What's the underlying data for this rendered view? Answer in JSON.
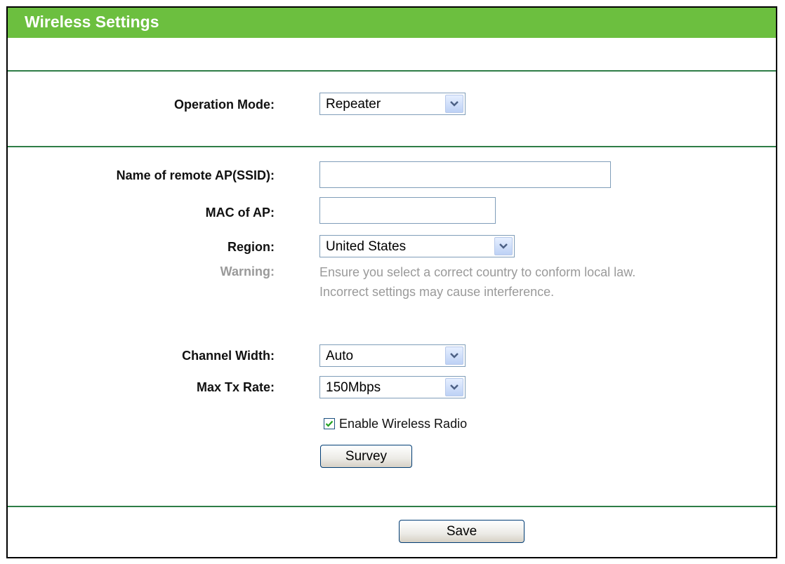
{
  "page": {
    "title": "Wireless Settings",
    "accent_color": "#6cbf3f",
    "divider_color": "#2e7d46"
  },
  "operation_mode": {
    "label": "Operation Mode:",
    "value": "Repeater"
  },
  "remote_ap": {
    "ssid_label": "Name of remote AP(SSID):",
    "ssid_value": "",
    "mac_label": "MAC of AP:",
    "mac_value": ""
  },
  "region": {
    "label": "Region:",
    "value": "United States",
    "warning_label": "Warning:",
    "warning_line1": "Ensure you select a correct country to conform local law.",
    "warning_line2": "Incorrect settings may cause interference."
  },
  "channel_width": {
    "label": "Channel Width:",
    "value": "Auto"
  },
  "max_tx_rate": {
    "label": "Max Tx Rate:",
    "value": "150Mbps"
  },
  "wireless_radio": {
    "label": "Enable Wireless Radio",
    "checked": true
  },
  "buttons": {
    "survey": "Survey",
    "save": "Save"
  },
  "icons": {
    "dropdown": "chevron-down-icon",
    "check": "checkmark-icon"
  }
}
